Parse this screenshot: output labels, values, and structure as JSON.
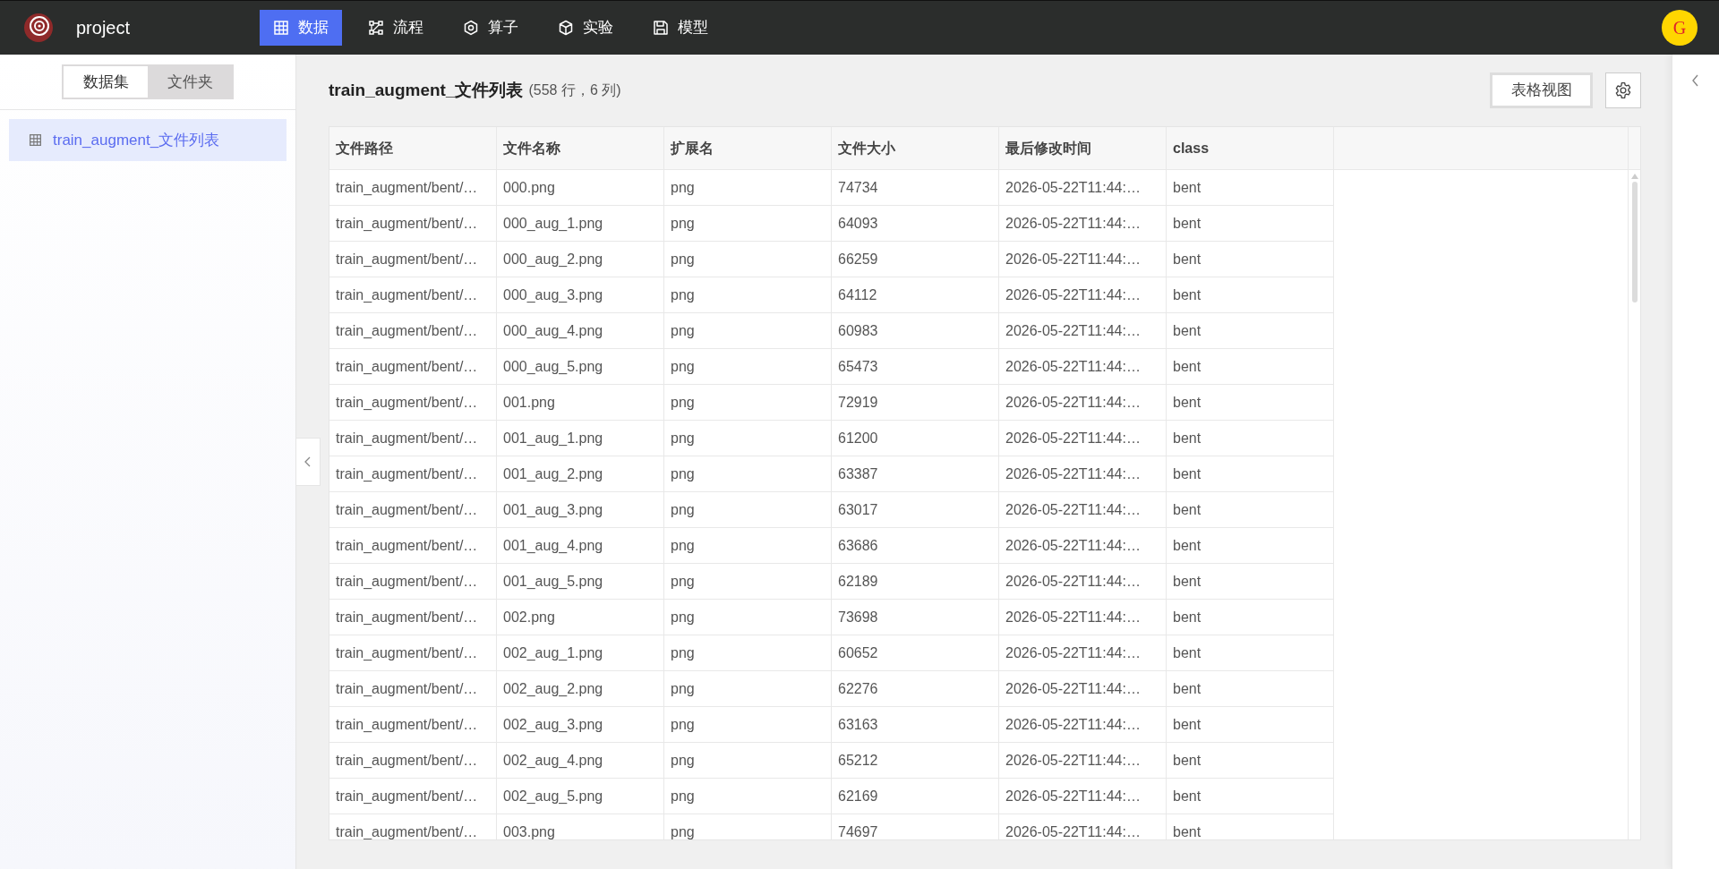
{
  "header": {
    "app_name": "project",
    "nav": [
      {
        "label": "数据",
        "selected": true
      },
      {
        "label": "流程",
        "selected": false
      },
      {
        "label": "算子",
        "selected": false
      },
      {
        "label": "实验",
        "selected": false
      },
      {
        "label": "模型",
        "selected": false
      }
    ],
    "avatar": "G"
  },
  "sidebar": {
    "tabs": [
      {
        "label": "数据集",
        "selected": true
      },
      {
        "label": "文件夹",
        "selected": false
      }
    ],
    "items": [
      {
        "label": "train_augment_文件列表",
        "selected": true
      }
    ]
  },
  "main": {
    "title": "train_augment_文件列表",
    "summary": "(558 行，6 列)",
    "view_button": "表格视图",
    "table": {
      "columns": [
        "文件路径",
        "文件名称",
        "扩展名",
        "文件大小",
        "最后修改时间",
        "class"
      ],
      "rows": [
        [
          "train_augment/bent/…",
          "000.png",
          "png",
          "74734",
          "2026-05-22T11:44:…",
          "bent"
        ],
        [
          "train_augment/bent/…",
          "000_aug_1.png",
          "png",
          "64093",
          "2026-05-22T11:44:…",
          "bent"
        ],
        [
          "train_augment/bent/…",
          "000_aug_2.png",
          "png",
          "66259",
          "2026-05-22T11:44:…",
          "bent"
        ],
        [
          "train_augment/bent/…",
          "000_aug_3.png",
          "png",
          "64112",
          "2026-05-22T11:44:…",
          "bent"
        ],
        [
          "train_augment/bent/…",
          "000_aug_4.png",
          "png",
          "60983",
          "2026-05-22T11:44:…",
          "bent"
        ],
        [
          "train_augment/bent/…",
          "000_aug_5.png",
          "png",
          "65473",
          "2026-05-22T11:44:…",
          "bent"
        ],
        [
          "train_augment/bent/…",
          "001.png",
          "png",
          "72919",
          "2026-05-22T11:44:…",
          "bent"
        ],
        [
          "train_augment/bent/…",
          "001_aug_1.png",
          "png",
          "61200",
          "2026-05-22T11:44:…",
          "bent"
        ],
        [
          "train_augment/bent/…",
          "001_aug_2.png",
          "png",
          "63387",
          "2026-05-22T11:44:…",
          "bent"
        ],
        [
          "train_augment/bent/…",
          "001_aug_3.png",
          "png",
          "63017",
          "2026-05-22T11:44:…",
          "bent"
        ],
        [
          "train_augment/bent/…",
          "001_aug_4.png",
          "png",
          "63686",
          "2026-05-22T11:44:…",
          "bent"
        ],
        [
          "train_augment/bent/…",
          "001_aug_5.png",
          "png",
          "62189",
          "2026-05-22T11:44:…",
          "bent"
        ],
        [
          "train_augment/bent/…",
          "002.png",
          "png",
          "73698",
          "2026-05-22T11:44:…",
          "bent"
        ],
        [
          "train_augment/bent/…",
          "002_aug_1.png",
          "png",
          "60652",
          "2026-05-22T11:44:…",
          "bent"
        ],
        [
          "train_augment/bent/…",
          "002_aug_2.png",
          "png",
          "62276",
          "2026-05-22T11:44:…",
          "bent"
        ],
        [
          "train_augment/bent/…",
          "002_aug_3.png",
          "png",
          "63163",
          "2026-05-22T11:44:…",
          "bent"
        ],
        [
          "train_augment/bent/…",
          "002_aug_4.png",
          "png",
          "65212",
          "2026-05-22T11:44:…",
          "bent"
        ],
        [
          "train_augment/bent/…",
          "002_aug_5.png",
          "png",
          "62169",
          "2026-05-22T11:44:…",
          "bent"
        ],
        [
          "train_augment/bent/…",
          "003.png",
          "png",
          "74697",
          "2026-05-22T11:44:…",
          "bent"
        ]
      ]
    }
  }
}
